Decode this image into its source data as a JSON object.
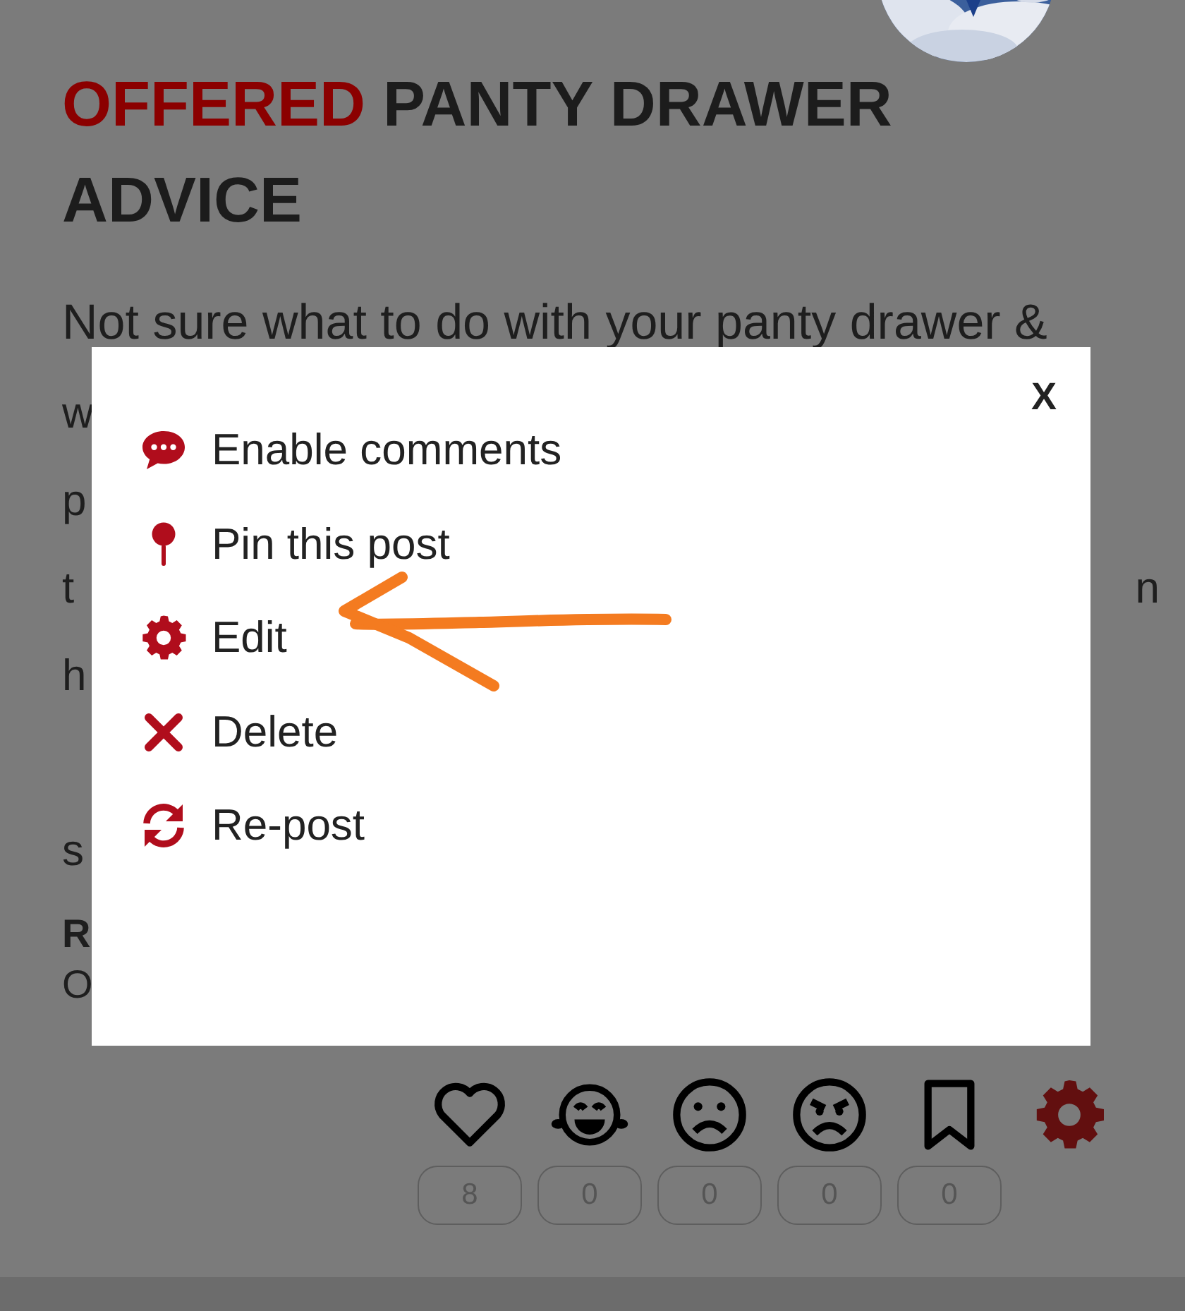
{
  "post": {
    "status": "OFFERED",
    "title": "PANTY DRAWER ADVICE",
    "first_line": "Not sure what to do with your panty drawer &",
    "covered_lines": [
      {
        "left": "w"
      },
      {
        "left": "p"
      },
      {
        "left": "t",
        "right": "n"
      },
      {
        "left": "h"
      },
      {
        "left": "s"
      }
    ],
    "meta_label": "R",
    "meta_value": "O"
  },
  "reactions": [
    {
      "kind": "heart",
      "count": "8"
    },
    {
      "kind": "laugh",
      "count": "0"
    },
    {
      "kind": "sad",
      "count": "0"
    },
    {
      "kind": "angry",
      "count": "0"
    },
    {
      "kind": "bookmark",
      "count": "0"
    },
    {
      "kind": "settings",
      "active": true
    }
  ],
  "menu": {
    "close": "X",
    "items": [
      {
        "kind": "comment",
        "label": "Enable comments"
      },
      {
        "kind": "pin",
        "label": "Pin this post"
      },
      {
        "kind": "gear",
        "label": "Edit"
      },
      {
        "kind": "cross",
        "label": "Delete"
      },
      {
        "kind": "repost",
        "label": "Re-post"
      }
    ]
  }
}
